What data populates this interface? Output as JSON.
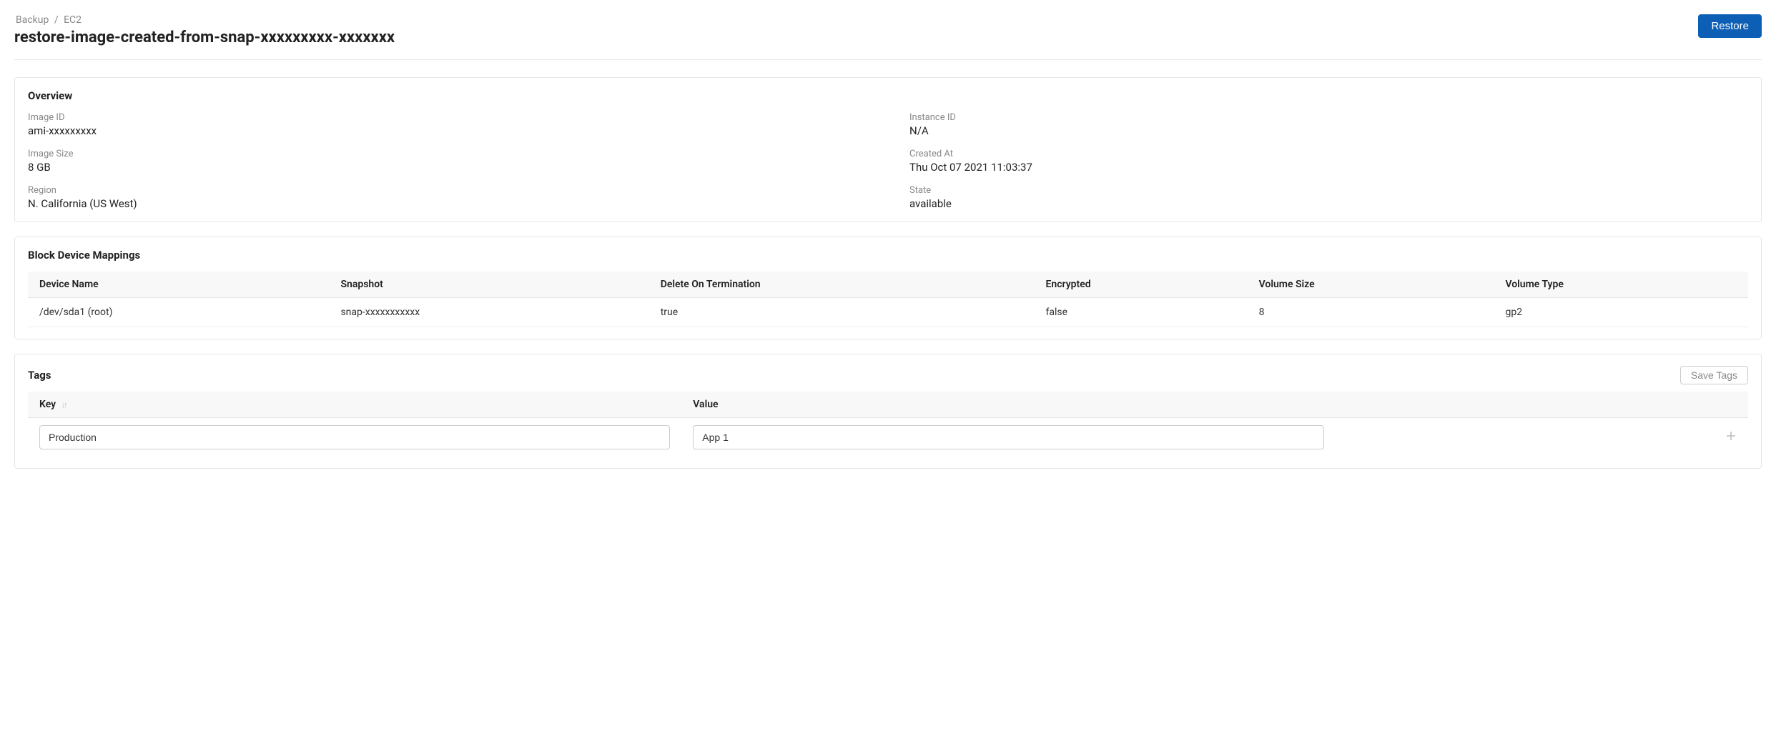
{
  "breadcrumb": {
    "item0": "Backup",
    "sep": "/",
    "item1": "EC2"
  },
  "page_title": "restore-image-created-from-snap-xxxxxxxxx-xxxxxxx",
  "restore_btn": "Restore",
  "overview": {
    "title": "Overview",
    "image_id_label": "Image ID",
    "image_id_value": "ami-xxxxxxxxx",
    "instance_id_label": "Instance ID",
    "instance_id_value": "N/A",
    "image_size_label": "Image Size",
    "image_size_value": "8 GB",
    "created_at_label": "Created At",
    "created_at_value": "Thu Oct 07 2021 11:03:37",
    "region_label": "Region",
    "region_value": "N. California (US West)",
    "state_label": "State",
    "state_value": "available"
  },
  "block_device": {
    "title": "Block Device Mappings",
    "headers": {
      "device_name": "Device Name",
      "snapshot": "Snapshot",
      "delete_on_termination": "Delete On Termination",
      "encrypted": "Encrypted",
      "volume_size": "Volume Size",
      "volume_type": "Volume Type"
    },
    "rows": [
      {
        "device_name": "/dev/sda1 (root)",
        "snapshot": "snap-xxxxxxxxxxx",
        "delete_on_termination": "true",
        "encrypted": "false",
        "volume_size": "8",
        "volume_type": "gp2"
      }
    ]
  },
  "tags": {
    "title": "Tags",
    "save_btn": "Save Tags",
    "key_header": "Key",
    "value_header": "Value",
    "sort_indicator": "↓↑",
    "rows": [
      {
        "key": "Production",
        "value": "App 1"
      }
    ],
    "add_icon": "+"
  }
}
